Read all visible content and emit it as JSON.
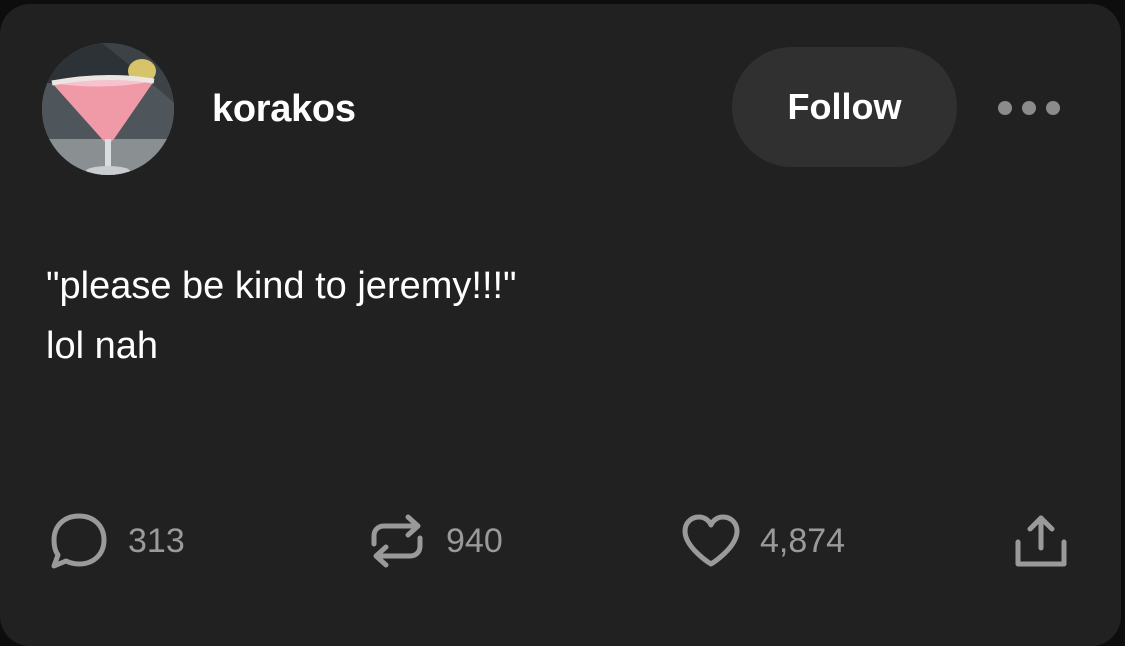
{
  "post": {
    "author": "korakos",
    "follow_label": "Follow",
    "body_lines": [
      "\"please be kind to jeremy!!!\"",
      "lol nah"
    ]
  },
  "actions": {
    "replies": "313",
    "reblogs": "940",
    "likes": "4,874"
  },
  "icons": {
    "avatar": "pink-cocktail-photo",
    "more": "ellipsis-icon",
    "reply": "speech-bubble-icon",
    "reblog": "repeat-arrows-icon",
    "like": "heart-icon",
    "share": "share-upload-icon"
  },
  "colors": {
    "page_background": "#0d0d0d",
    "card_background": "#212121",
    "button_background": "#303030",
    "text_primary": "#ffffff",
    "text_secondary": "#9a9a9a"
  }
}
